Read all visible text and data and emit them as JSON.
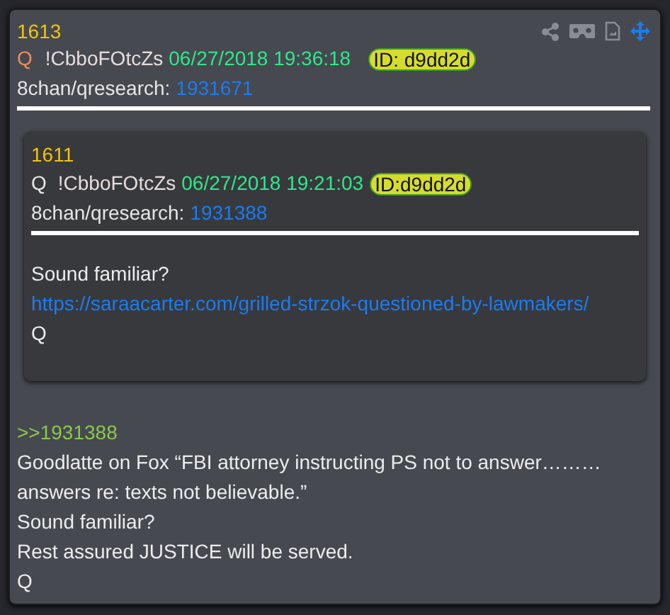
{
  "post": {
    "number": "1613",
    "author": "Q",
    "tripcode": "!CbboFOtcZs",
    "timestamp": "06/27/2018 19:36:18",
    "id_badge": "ID: d9dd2d",
    "board": "8chan/qresearch:",
    "post_link": "1931671"
  },
  "quoted_post": {
    "number": "1611",
    "author": "Q",
    "tripcode": "!CbboFOtcZs",
    "timestamp": "06/27/2018 19:21:03",
    "id_badge": "ID:d9dd2d",
    "board": "8chan/qresearch:",
    "post_link": "1931388",
    "body": [
      {
        "kind": "text",
        "text": "Sound familiar?"
      },
      {
        "kind": "link",
        "text": "https://saraacarter.com/grilled-strzok-questioned-by-lawmakers/"
      },
      {
        "kind": "text",
        "text": "Q"
      }
    ]
  },
  "reply": {
    "reference": ">>1931388",
    "lines": [
      "Goodlatte on Fox “FBI attorney instructing PS not to answer………",
      "answers re: texts not believable.”",
      "Sound familiar?",
      "Rest assured JUSTICE will be served.",
      "Q"
    ]
  }
}
